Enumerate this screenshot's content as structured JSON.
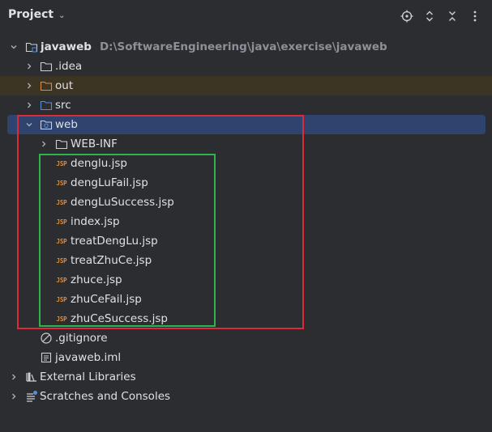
{
  "header": {
    "title": "Project",
    "icons": [
      "crosshair-icon",
      "expand-icon",
      "collapse-icon",
      "more-icon"
    ]
  },
  "tree": {
    "root": {
      "label": "javaweb",
      "path": "D:\\SoftwareEngineering\\java\\exercise\\javaweb"
    },
    "idea": ".idea",
    "out": "out",
    "src": "src",
    "web": "web",
    "webinf": "WEB-INF",
    "jsp_tag": "JSP",
    "jsp_files": [
      "denglu.jsp",
      "dengLuFail.jsp",
      "dengLuSuccess.jsp",
      "index.jsp",
      "treatDengLu.jsp",
      "treatZhuCe.jsp",
      "zhuce.jsp",
      "zhuCeFail.jsp",
      "zhuCeSuccess.jsp"
    ],
    "gitignore": ".gitignore",
    "iml": "javaweb.iml",
    "external_libraries": "External Libraries",
    "scratches": "Scratches and Consoles"
  },
  "colors": {
    "background": "#2b2d30",
    "selection": "#2e436e",
    "excluded_row": "#3d3523",
    "highlight_red": "#d92b3a",
    "highlight_green": "#2fb34a",
    "jsp_icon": "#e08a3c"
  }
}
